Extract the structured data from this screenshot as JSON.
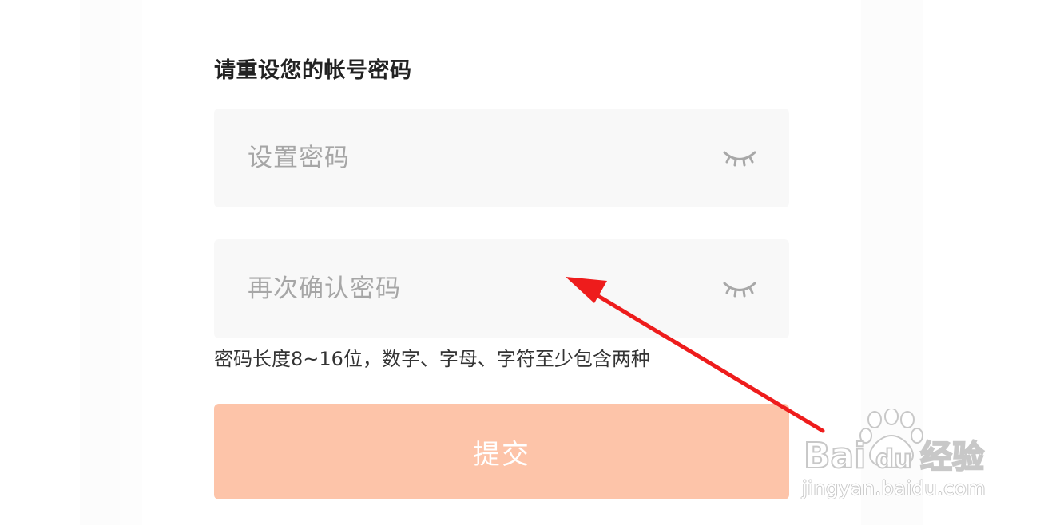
{
  "form": {
    "title": "请重设您的帐号密码",
    "password_placeholder": "设置密码",
    "confirm_placeholder": "再次确认密码",
    "hint": "密码长度8~16位，数字、字母、字符至少包含两种",
    "submit_label": "提交"
  },
  "icons": {
    "password_toggle": "eye-closed-icon",
    "confirm_toggle": "eye-closed-icon"
  },
  "colors": {
    "submit_bg": "#fdc4a9",
    "field_bg": "#f8f8f8",
    "arrow": "#ee1c1c"
  },
  "watermark": {
    "brand": "Baidu经验",
    "url": "jingyan.baidu.com"
  }
}
